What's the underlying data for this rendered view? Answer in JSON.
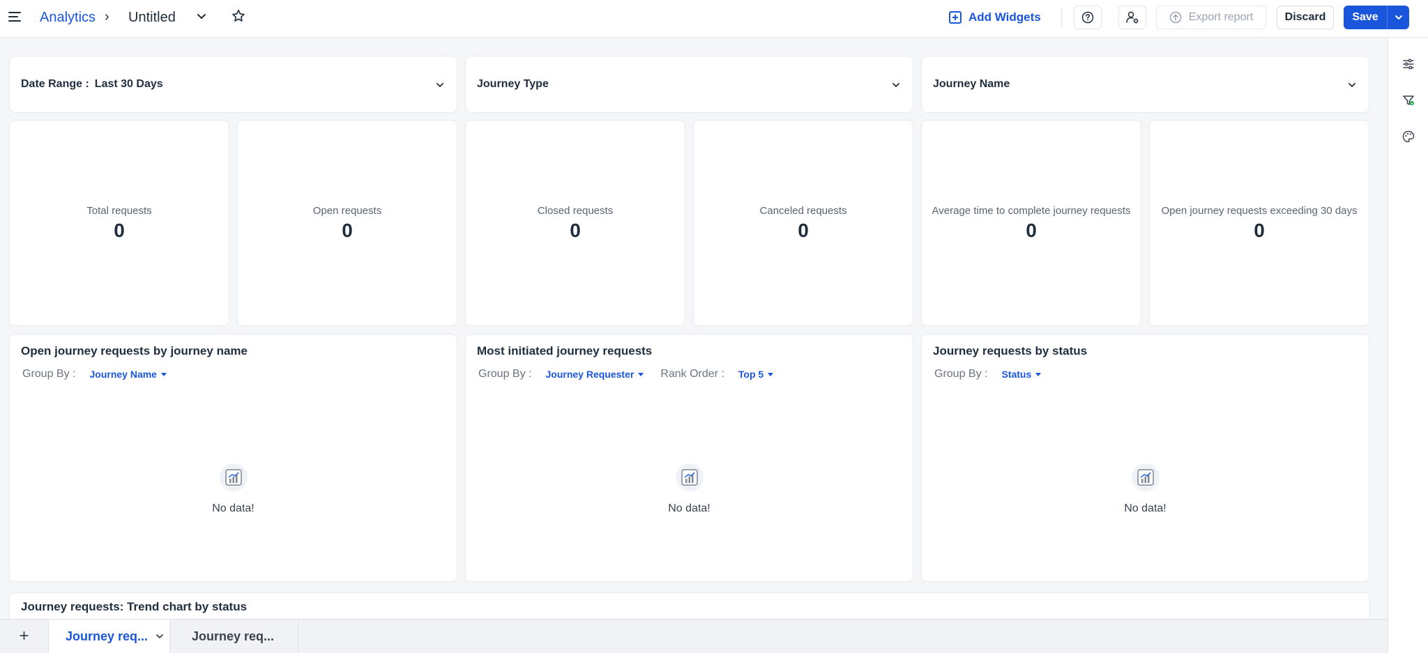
{
  "header": {
    "app_name": "Analytics",
    "breadcrumb_sep": "›",
    "report_title": "Untitled",
    "add_widgets": "Add Widgets",
    "export": "Export report",
    "discard": "Discard",
    "save": "Save"
  },
  "filters": [
    {
      "label": "Date Range :",
      "value": "Last 30 Days"
    },
    {
      "label": "Journey Type",
      "value": ""
    },
    {
      "label": "Journey Name",
      "value": ""
    }
  ],
  "kpis": [
    {
      "label": "Total requests",
      "value": "0"
    },
    {
      "label": "Open requests",
      "value": "0"
    },
    {
      "label": "Closed requests",
      "value": "0"
    },
    {
      "label": "Canceled requests",
      "value": "0"
    },
    {
      "label": "Average time to complete journey requests",
      "value": "0"
    },
    {
      "label": "Open journey requests exceeding 30 days",
      "value": "0"
    }
  ],
  "widgets": [
    {
      "title": "Open journey requests by journey name",
      "group_by_label": "Group By :",
      "group_by_value": "Journey Name",
      "empty_text": "No data!"
    },
    {
      "title": "Most initiated journey requests",
      "group_by_label": "Group By :",
      "group_by_value": "Journey Requester",
      "rank_label": "Rank Order :",
      "rank_value": "Top 5",
      "empty_text": "No data!"
    },
    {
      "title": "Journey requests by status",
      "group_by_label": "Group By :",
      "group_by_value": "Status",
      "empty_text": "No data!"
    }
  ],
  "trend": {
    "title": "Journey requests: Trend chart by status"
  },
  "tabs": [
    {
      "label": "Journey req...",
      "active": true
    },
    {
      "label": "Journey req...",
      "active": false
    }
  ],
  "tab_add": "+",
  "colors": {
    "accent": "#1a56db",
    "text": "#1f2d3d",
    "canvas": "#f4f6f8"
  }
}
